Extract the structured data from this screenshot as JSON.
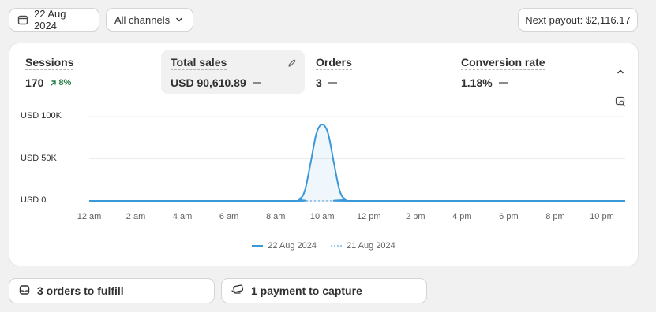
{
  "toolbar": {
    "date_label": "22 Aug 2024",
    "channel_label": "All channels",
    "payout_label": "Next payout: $2,116.17"
  },
  "metrics": [
    {
      "title": "Sessions",
      "value": "170",
      "trend": "8%"
    },
    {
      "title": "Total sales",
      "value": "USD 90,610.89"
    },
    {
      "title": "Orders",
      "value": "3"
    },
    {
      "title": "Conversion rate",
      "value": "1.18%"
    }
  ],
  "chart_data": {
    "type": "line",
    "y_ticks": [
      "USD 100K",
      "USD 50K",
      "USD 0"
    ],
    "y_tick_values": [
      100000,
      50000,
      0
    ],
    "ylim": [
      0,
      100000
    ],
    "x_ticks": [
      "12 am",
      "2 am",
      "4 am",
      "6 am",
      "8 am",
      "10 am",
      "12 pm",
      "2 pm",
      "4 pm",
      "6 pm",
      "8 pm",
      "10 pm"
    ],
    "xlim": [
      0,
      23
    ],
    "grid": true,
    "legend_position": "bottom",
    "series": [
      {
        "name": "22 Aug 2024",
        "color": "#3a97d8",
        "style": "solid",
        "x": [
          0,
          8.5,
          9,
          9.25,
          9.5,
          9.75,
          10,
          10.25,
          10.5,
          10.75,
          11,
          11.5,
          23
        ],
        "y": [
          0,
          0,
          2000,
          12000,
          45000,
          80000,
          90610.89,
          80000,
          45000,
          12000,
          2000,
          0,
          0
        ]
      },
      {
        "name": "21 Aug 2024",
        "color": "#9ccaec",
        "style": "dotted",
        "x": [
          0,
          23
        ],
        "y": [
          0,
          0
        ]
      }
    ]
  },
  "tasks": [
    {
      "label": "3 orders to fulfill",
      "icon": "inbox-icon"
    },
    {
      "label": "1 payment to capture",
      "icon": "payment-icon"
    }
  ]
}
